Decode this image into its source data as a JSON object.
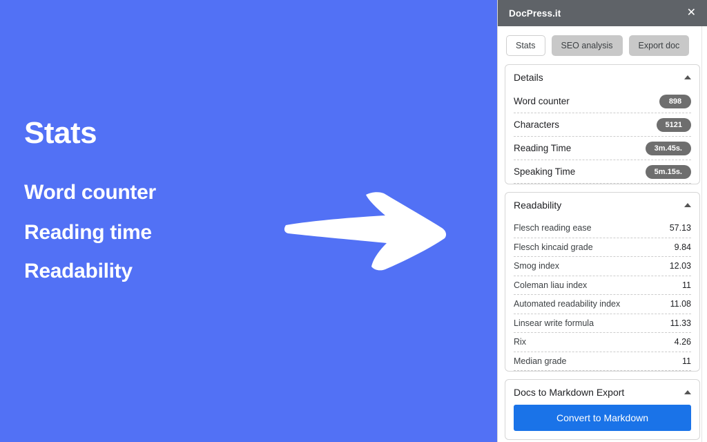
{
  "promo": {
    "background_color": "#5271f5",
    "title": "Stats",
    "lines": [
      "Word counter",
      "Reading time",
      "Readability"
    ],
    "arrow_icon": "arrow-right-hand-drawn"
  },
  "sidebar": {
    "header": {
      "app_title": "DocPress.it",
      "close_icon": "close-icon",
      "background_color": "#5f6368"
    },
    "tabs": [
      {
        "label": "Stats",
        "active": true
      },
      {
        "label": "SEO analysis",
        "active": false
      },
      {
        "label": "Export doc",
        "active": false
      }
    ],
    "details_card": {
      "title": "Details",
      "caret_icon": "caret-up-icon",
      "rows": [
        {
          "label": "Word counter",
          "value": "898"
        },
        {
          "label": "Characters",
          "value": "5121"
        },
        {
          "label": "Reading Time",
          "value": "3m.45s."
        },
        {
          "label": "Speaking Time",
          "value": "5m.15s."
        }
      ]
    },
    "readability_card": {
      "title": "Readability",
      "caret_icon": "caret-up-icon",
      "rows": [
        {
          "label": "Flesch reading ease",
          "value": "57.13"
        },
        {
          "label": "Flesch kincaid grade",
          "value": "9.84"
        },
        {
          "label": "Smog index",
          "value": "12.03"
        },
        {
          "label": "Coleman liau index",
          "value": "11"
        },
        {
          "label": "Automated readability index",
          "value": "11.08"
        },
        {
          "label": "Linsear write formula",
          "value": "11.33"
        },
        {
          "label": "Rix",
          "value": "4.26"
        },
        {
          "label": "Median grade",
          "value": "11"
        }
      ]
    },
    "export_card": {
      "title": "Docs to Markdown Export",
      "caret_icon": "caret-up-icon",
      "button_label": "Convert to Markdown",
      "button_color": "#1a73e8"
    }
  }
}
